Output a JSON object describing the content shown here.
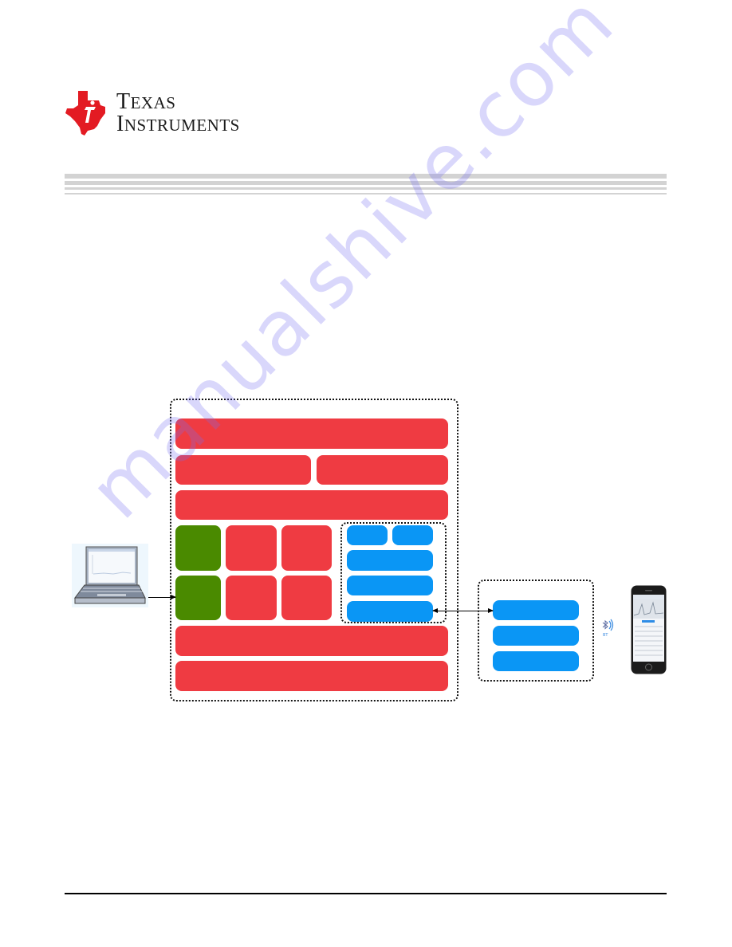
{
  "header": {
    "brand": {
      "name": "Texas Instruments",
      "line1_big": "T",
      "line1_small": "EXAS",
      "line2_big": "I",
      "line2_small": "NSTRUMENTS",
      "logo_color": "#e31b23"
    }
  },
  "diagram": {
    "colors": {
      "application_block": "#ef3b42",
      "driver_block": "#4a8a00",
      "ble_block": "#0a96f5",
      "border": "#111111"
    },
    "main_board": {
      "rows": [
        {
          "blocks": [
            ""
          ]
        },
        {
          "blocks": [
            "",
            ""
          ]
        },
        {
          "blocks": [
            ""
          ]
        }
      ],
      "grid": {
        "green_blocks": [
          "",
          ""
        ],
        "red_blocks": [
          "",
          "",
          "",
          ""
        ]
      },
      "ble_stack_group": {
        "top_blocks": [
          "",
          ""
        ],
        "stack_blocks": [
          "",
          "",
          ""
        ]
      },
      "bottom_rows": [
        {
          "blocks": [
            ""
          ]
        },
        {
          "blocks": [
            ""
          ]
        }
      ]
    },
    "ble_module": {
      "blocks": [
        "",
        "",
        ""
      ]
    },
    "devices": {
      "laptop": "laptop-icon",
      "phone": "smartphone-icon",
      "wireless": "bluetooth-icon"
    }
  },
  "watermark": "manualshive.com"
}
